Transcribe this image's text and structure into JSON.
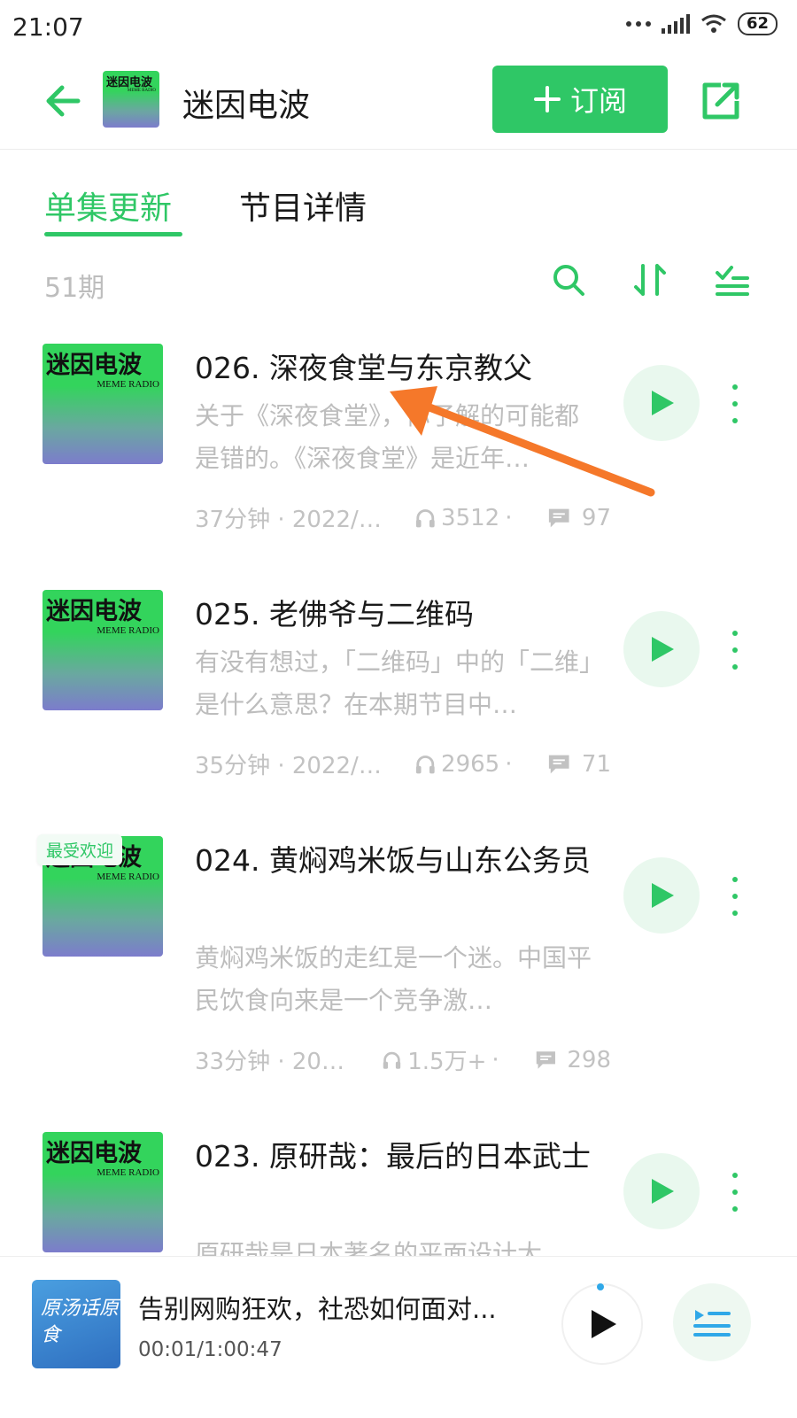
{
  "status_bar": {
    "time": "21:07",
    "battery": "62"
  },
  "header": {
    "podcast_title": "迷因电波",
    "subscribe_label": "订阅"
  },
  "tabs": [
    {
      "label": "单集更新",
      "active": true
    },
    {
      "label": "节目详情",
      "active": false
    }
  ],
  "toolbar": {
    "episode_count": "51期"
  },
  "cover_art": {
    "title": "迷因电波",
    "subtitle": "MEME RADIO"
  },
  "episodes": [
    {
      "title": "026. 深夜食堂与东京教父",
      "description": "关于《深夜食堂》，你了解的可能都是错的。《深夜食堂》是近年…",
      "duration": "37分钟 · 2022/0...",
      "plays": "3512",
      "comments": "97",
      "badge": ""
    },
    {
      "title": "025. 老佛爷与二维码",
      "description": "有没有想过，「二维码」中的「二维」是什么意思？在本期节目中…",
      "duration": "35分钟 · 2022/0...",
      "plays": "2965",
      "comments": "71",
      "badge": ""
    },
    {
      "title": "024. 黄焖鸡米饭与山东公务员",
      "description": "黄焖鸡米饭的走红是一个迷。中国平民饮食向来是一个竞争激…",
      "duration": "33分钟 · 2022...",
      "plays": "1.5万+",
      "comments": "298",
      "badge": "最受欢迎"
    },
    {
      "title": "023. 原研哉：最后的日本武士",
      "description": "原研哉是日本著名的平面设计大",
      "duration": "",
      "plays": "",
      "comments": "",
      "badge": ""
    }
  ],
  "player": {
    "cover_text": "原汤话原食",
    "title": "告别网购狂欢，社恐如何面对...",
    "time": "00:01/1:00:47"
  },
  "colors": {
    "accent": "#2fc766",
    "annotation_arrow": "#f5782a"
  },
  "icons": [
    "back-arrow-icon",
    "share-icon",
    "search-icon",
    "sort-icon",
    "filter-list-icon",
    "play-icon",
    "more-vertical-icon",
    "headphones-icon",
    "comment-icon",
    "playlist-icon"
  ]
}
